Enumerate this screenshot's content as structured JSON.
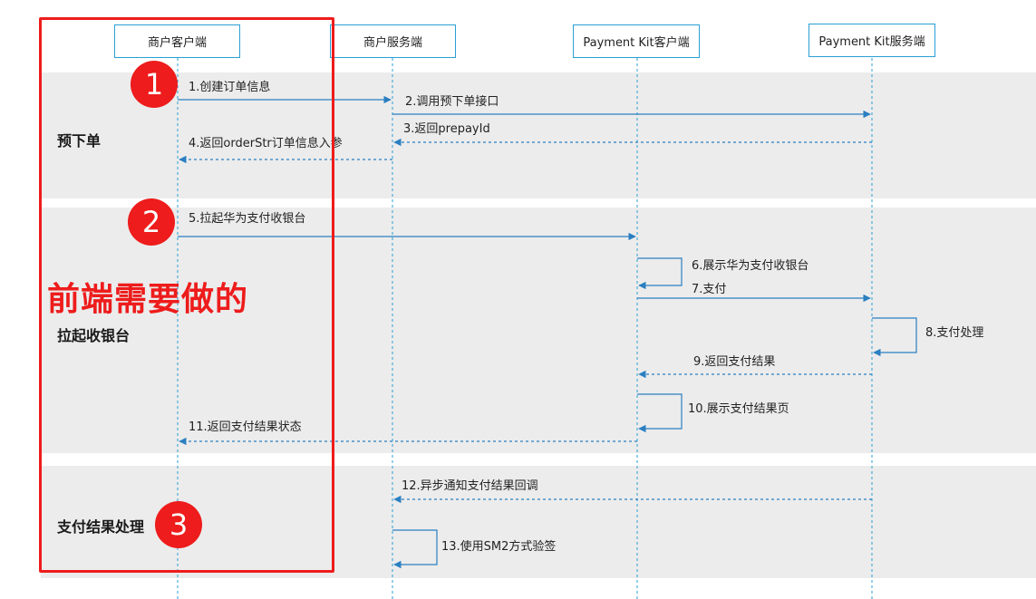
{
  "participants": [
    {
      "id": "merchant_client",
      "label": "商户客户端"
    },
    {
      "id": "merchant_server",
      "label": "商户服务端"
    },
    {
      "id": "kit_client",
      "label": "Payment Kit客户端"
    },
    {
      "id": "kit_server",
      "label": "Payment Kit服务端"
    }
  ],
  "phases": [
    {
      "label": "预下单"
    },
    {
      "label": "拉起收银台"
    },
    {
      "label": "支付结果处理"
    }
  ],
  "messages": [
    {
      "label": "1.创建订单信息",
      "from": "merchant_client",
      "to": "merchant_server",
      "style": "solid"
    },
    {
      "label": "2.调用预下单接口",
      "from": "merchant_server",
      "to": "kit_server",
      "style": "solid"
    },
    {
      "label": "3.返回prepayId",
      "from": "kit_server",
      "to": "merchant_server",
      "style": "dashed"
    },
    {
      "label": "4.返回orderStr订单信息入参",
      "from": "merchant_server",
      "to": "merchant_client",
      "style": "dashed"
    },
    {
      "label": "5.拉起华为支付收银台",
      "from": "merchant_client",
      "to": "kit_client",
      "style": "solid"
    },
    {
      "label": "6.展示华为支付收银台",
      "from": "kit_client",
      "to": "kit_client",
      "style": "self"
    },
    {
      "label": "7.支付",
      "from": "kit_client",
      "to": "kit_server",
      "style": "solid"
    },
    {
      "label": "8.支付处理",
      "from": "kit_server",
      "to": "kit_server",
      "style": "self"
    },
    {
      "label": "9.返回支付结果",
      "from": "kit_server",
      "to": "kit_client",
      "style": "dashed"
    },
    {
      "label": "10.展示支付结果页",
      "from": "kit_client",
      "to": "kit_client",
      "style": "self"
    },
    {
      "label": "11.返回支付结果状态",
      "from": "kit_client",
      "to": "merchant_client",
      "style": "dashed"
    },
    {
      "label": "12.异步通知支付结果回调",
      "from": "kit_server",
      "to": "merchant_server",
      "style": "dashed"
    },
    {
      "label": "13.使用SM2方式验签",
      "from": "merchant_server",
      "to": "merchant_server",
      "style": "self"
    }
  ],
  "annotation": {
    "text": "前端需要做的",
    "color": "#ee1c1c"
  },
  "badges": [
    "1",
    "2",
    "3"
  ],
  "colors": {
    "line": "#2a7fc1",
    "lifeline": "#2aa0d4",
    "phase_bg": "#ececec",
    "accent": "#ee1c1c"
  }
}
